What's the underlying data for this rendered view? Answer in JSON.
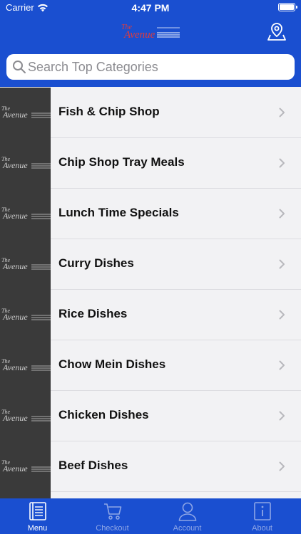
{
  "status_bar": {
    "carrier": "Carrier",
    "time": "4:47 PM"
  },
  "header": {
    "logo_icon": "the-avenue-logo",
    "location_icon": "map-pin-icon"
  },
  "search": {
    "placeholder": "Search Top Categories"
  },
  "categories": [
    {
      "label": "Fish & Chip Shop"
    },
    {
      "label": "Chip Shop Tray Meals"
    },
    {
      "label": "Lunch Time Specials"
    },
    {
      "label": "Curry Dishes"
    },
    {
      "label": "Rice Dishes"
    },
    {
      "label": "Chow Mein Dishes"
    },
    {
      "label": "Chicken Dishes"
    },
    {
      "label": "Beef Dishes"
    },
    {
      "label": ""
    }
  ],
  "tabs": [
    {
      "label": "Menu",
      "icon": "menu-icon",
      "active": true
    },
    {
      "label": "Checkout",
      "icon": "cart-icon",
      "active": false
    },
    {
      "label": "Account",
      "icon": "account-icon",
      "active": false
    },
    {
      "label": "About",
      "icon": "info-icon",
      "active": false
    }
  ],
  "colors": {
    "brand_blue": "#1a4fd0",
    "tab_inactive": "#8ea6e6",
    "tab_active": "#ffffff",
    "thumb_bg": "#3a3a3a"
  }
}
